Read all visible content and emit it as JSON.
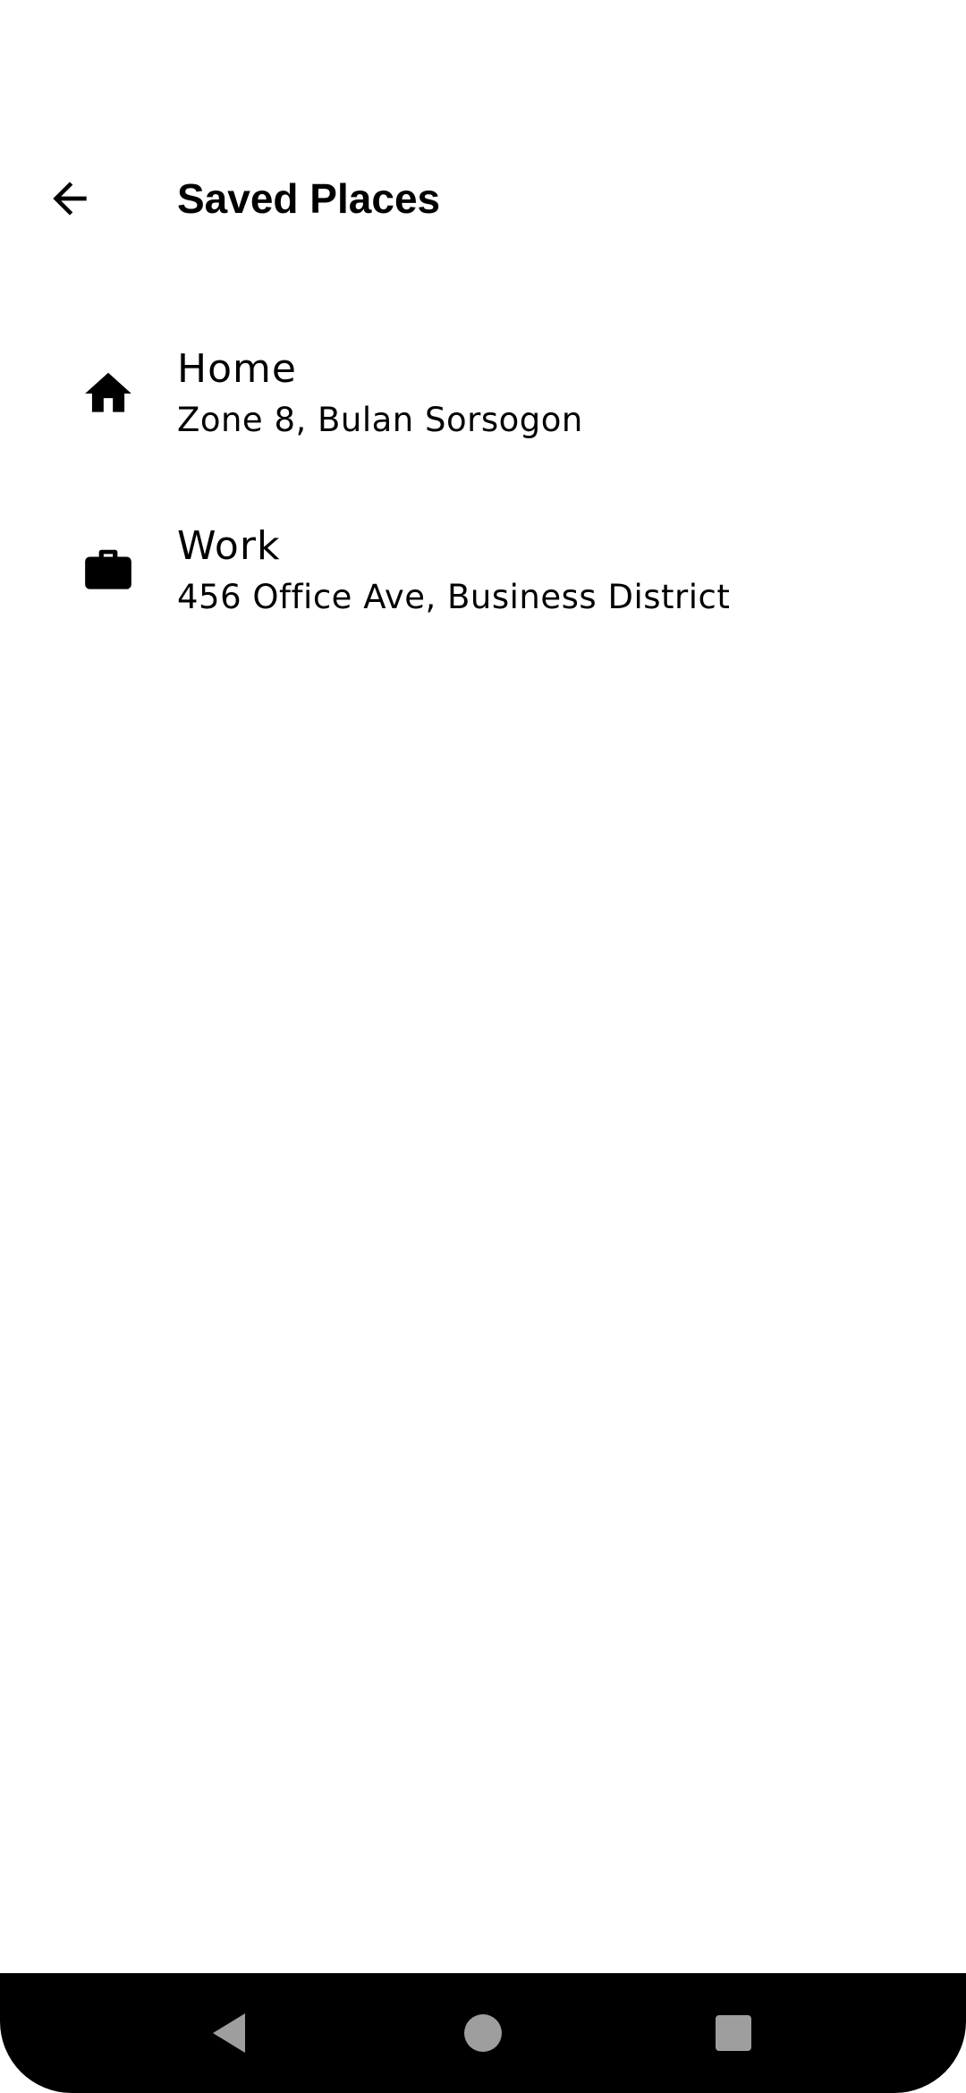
{
  "header": {
    "back_icon": "arrow-back-icon",
    "title": "Saved Places"
  },
  "places": [
    {
      "icon": "home-icon",
      "name": "Home",
      "address": "Zone 8, Bulan Sorsogon"
    },
    {
      "icon": "briefcase-icon",
      "name": "Work",
      "address": "456 Office Ave, Business District"
    }
  ],
  "system_nav": {
    "back_icon": "nav-back-triangle-icon",
    "home_icon": "nav-home-circle-icon",
    "recents_icon": "nav-recents-square-icon",
    "button_color": "#9e9e9e",
    "bar_color": "#000000"
  }
}
